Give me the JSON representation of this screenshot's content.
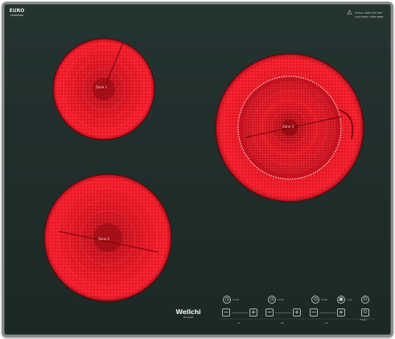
{
  "product": {
    "brand": "Wellchi",
    "model": "WI-3005"
  },
  "logos": {
    "euro_top": "EURO",
    "euro_bottom": "STANDARD"
  },
  "warning": {
    "icon": "warning-triangle-icon",
    "line1": "Hotline: 0965 909 999",
    "line2": "1900 0008 / 0965 6888"
  },
  "zones": [
    {
      "id": "zone-top-left",
      "label": "Zone 1"
    },
    {
      "id": "zone-right",
      "label": "Zone 3"
    },
    {
      "id": "zone-bottom-left",
      "label": "Zone 2"
    }
  ],
  "controls": {
    "timer_icons": [
      "timer-icon",
      "timer-icon",
      "timer-icon"
    ],
    "timer_labels": [
      "Timer",
      "Timer",
      "Timer"
    ],
    "lock_label": "Lock",
    "power_label": "Power",
    "lock_icon": "lock-icon",
    "power_icon": "power-icon",
    "minus": "−",
    "plus": "+",
    "zone_tags": [
      "Z1",
      "Z2",
      "Z3"
    ]
  },
  "colors": {
    "glass": "#1f2d2b",
    "frame": "#8a8f8e",
    "zone_hot": "#ff1a1a",
    "zone_dark": "#a0000a"
  }
}
